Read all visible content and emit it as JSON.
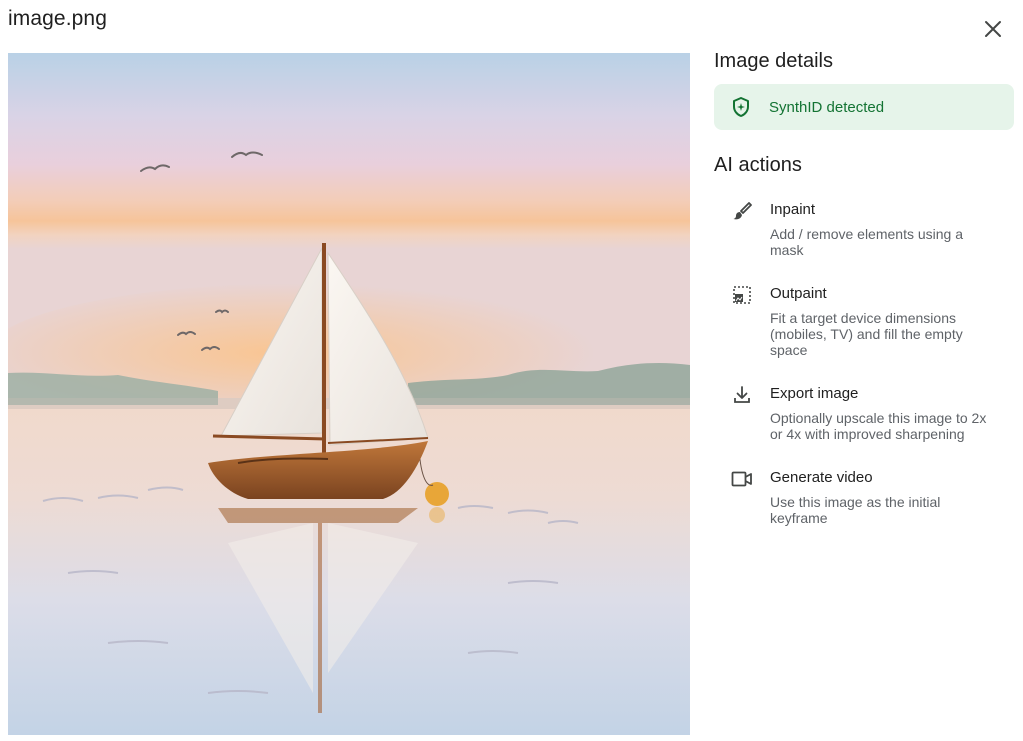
{
  "dialog": {
    "title": "image.png",
    "close_icon": "close-icon"
  },
  "image": {
    "alt": "Watercolor painting of a sailboat on calm water at sunset with birds in the sky"
  },
  "details": {
    "heading": "Image details",
    "synthid": {
      "icon": "shield-icon",
      "label": "SynthID detected",
      "background": "#e6f4ea",
      "color": "#137333"
    }
  },
  "ai_actions": {
    "heading": "AI actions",
    "items": [
      {
        "icon": "brush-icon",
        "label": "Inpaint",
        "description": "Add / remove elements using a mask"
      },
      {
        "icon": "outpaint-icon",
        "label": "Outpaint",
        "description": "Fit a target device dimensions (mobiles, TV) and fill the empty space"
      },
      {
        "icon": "download-icon",
        "label": "Export image",
        "description": "Optionally upscale this image to 2x or 4x with improved sharpening"
      },
      {
        "icon": "video-icon",
        "label": "Generate video",
        "description": "Use this image as the initial keyframe"
      }
    ]
  }
}
